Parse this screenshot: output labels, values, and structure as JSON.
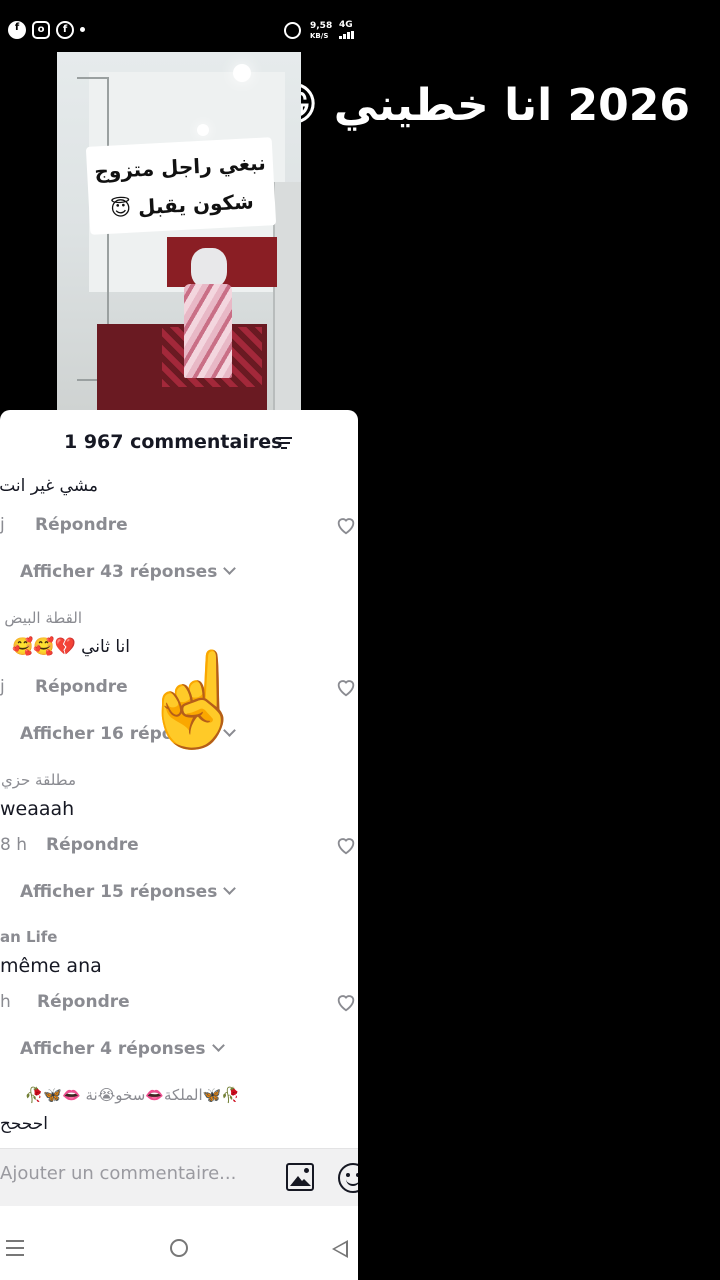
{
  "status_bar": {
    "speed": "9,58",
    "speed_unit": "KB/S",
    "network": "4G",
    "left_icons": [
      "facebook-icon",
      "instagram-icon",
      "facebook-icon",
      "dot"
    ]
  },
  "overlay": {
    "title": "2026 انا خطيني",
    "emojis": "😁🤐"
  },
  "video": {
    "caption_line1": "نبغي راجل متزوج",
    "caption_line2": "شكون يقبل 😇"
  },
  "comments_panel": {
    "count_label": "1 967 commentaires",
    "comments": [
      {
        "name": "",
        "text": "مشي غير انت",
        "time": "j",
        "reply_label": "Répondre",
        "more_label": "Afficher 43 réponses"
      },
      {
        "name": "القطة البيض",
        "text": "انا ثاني 💔🥰🥰",
        "time": "j",
        "reply_label": "Répondre",
        "more_label": "Afficher 16 réponses"
      },
      {
        "name": "مطلقة حزي",
        "text": "weaaah",
        "time": "8 h",
        "reply_label": "Répondre",
        "more_label": "Afficher 15 réponses"
      },
      {
        "name": "an Life",
        "text": "même ana",
        "time": "h",
        "reply_label": "Répondre",
        "more_label": "Afficher 4 réponses"
      },
      {
        "name": "🥀🦋الملكة👄سخو😭نة 👄🦋🥀",
        "text": "احححح",
        "time": "",
        "reply_label": "",
        "more_label": ""
      }
    ],
    "input_placeholder": "Ajouter un commentaire..."
  },
  "pointer_emoji": "☝️"
}
